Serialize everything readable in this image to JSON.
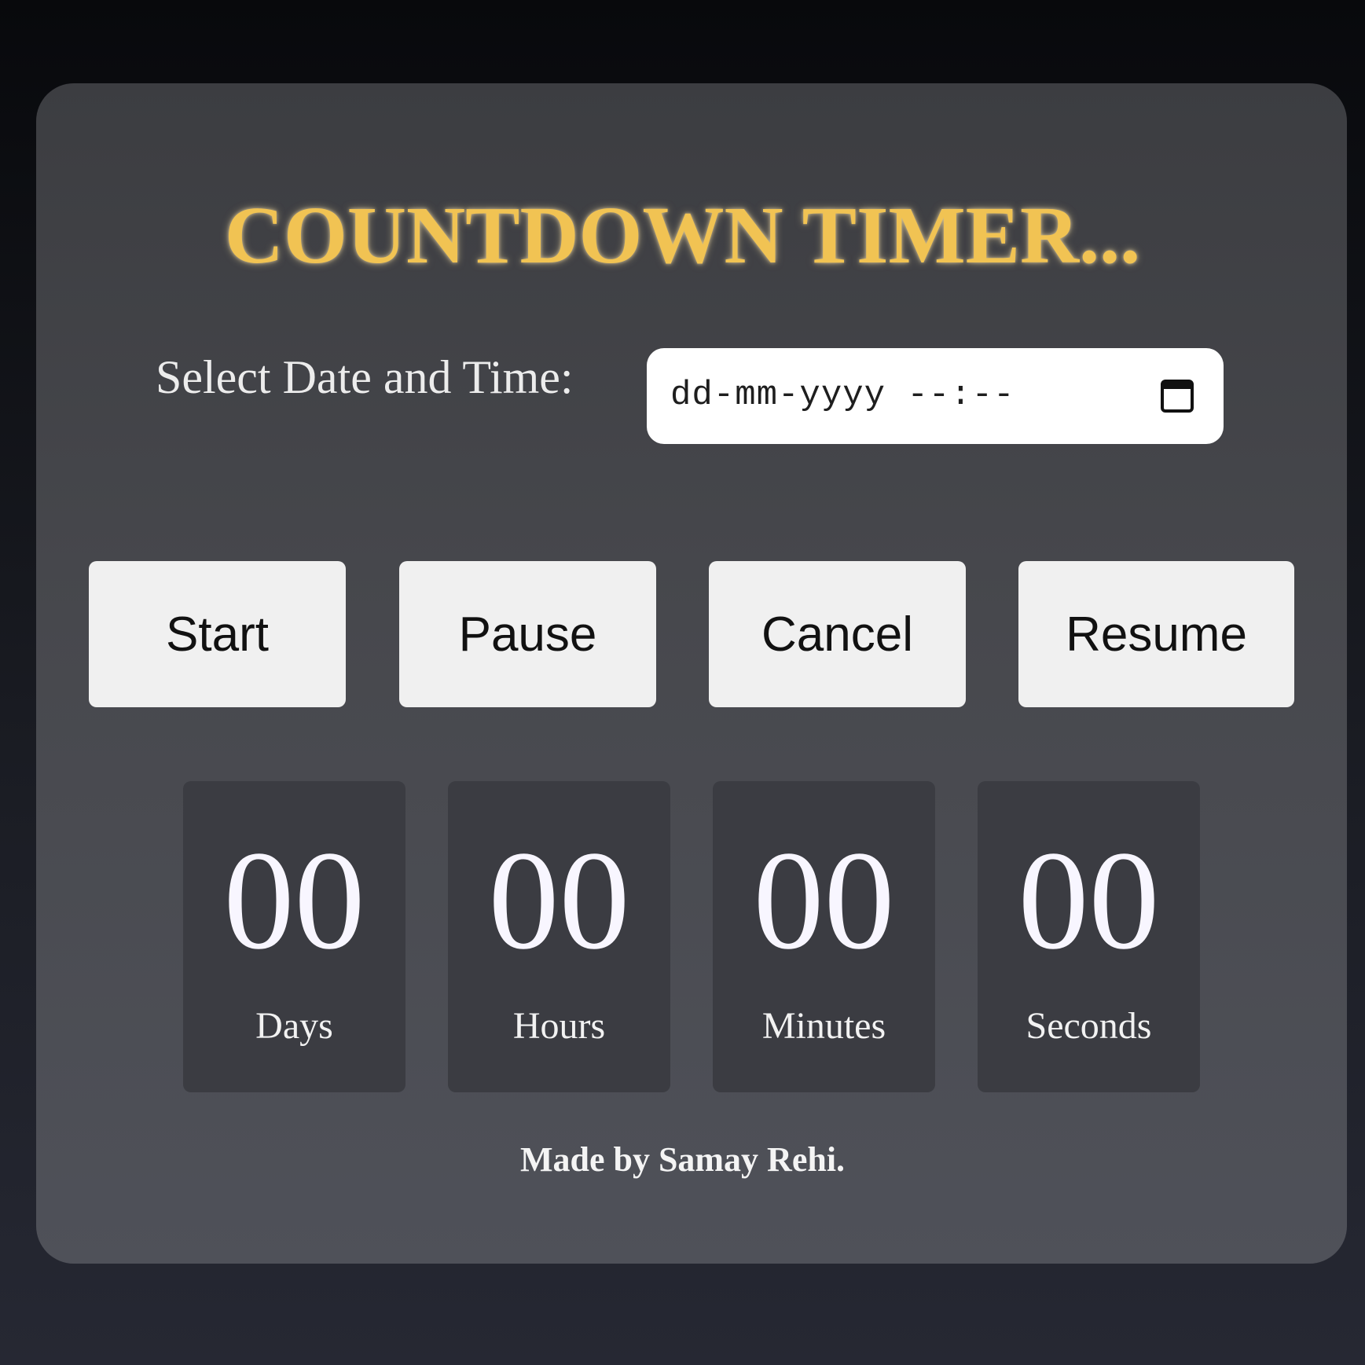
{
  "title": "COUNTDOWN TIMER...",
  "date_picker": {
    "label": "Select Date and Time:",
    "placeholder": "dd-mm-yyyy --:--",
    "icon": "calendar-icon"
  },
  "buttons": {
    "start": "Start",
    "pause": "Pause",
    "cancel": "Cancel",
    "resume": "Resume"
  },
  "countdown": [
    {
      "value": "00",
      "label": "Days"
    },
    {
      "value": "00",
      "label": "Hours"
    },
    {
      "value": "00",
      "label": "Minutes"
    },
    {
      "value": "00",
      "label": "Seconds"
    }
  ],
  "footer": "Made by Samay Rehi.",
  "colors": {
    "title": "#f1c353",
    "card_background": "#47484d",
    "tile_background": "#3b3c42",
    "button_background": "#f0f0f0"
  }
}
